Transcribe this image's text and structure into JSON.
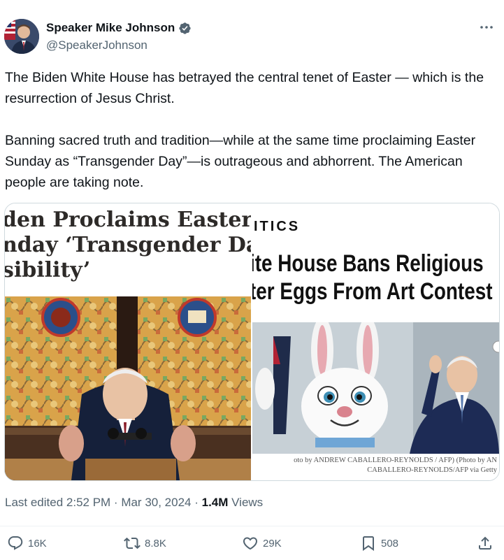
{
  "author": {
    "display_name": "Speaker Mike Johnson",
    "handle": "@SpeakerJohnson",
    "verified": true,
    "verified_color": "#536471"
  },
  "tweet": {
    "paragraphs": [
      "The Biden White House has betrayed the central tenet of Easter — which is the resurrection of Jesus Christ.",
      "Banning sacred truth and tradition—while at the same time proclaiming Easter Sunday as “Transgender Day”—is outrageous and abhorrent. The American people are taking note."
    ]
  },
  "media": {
    "left": {
      "headline_lines": [
        "den Proclaims Easter",
        "nday ‘Transgender Day",
        "sibility’"
      ]
    },
    "right": {
      "section_label": "ITICS",
      "headline_lines": [
        "ite House Bans Religious",
        "ter Eggs From Art Contest"
      ],
      "caption_lines": [
        "oto by ANDREW CABALLERO-REYNOLDS / AFP) (Photo by AN",
        "CABALLERO-REYNOLDS/AFP via Getty"
      ]
    }
  },
  "meta": {
    "edited": "Last edited 2:52 PM · Mar 30, 2024 · ",
    "views_count": "1.4M",
    "views_label": " Views"
  },
  "actions": {
    "replies": "16K",
    "reposts": "8.8K",
    "likes": "29K",
    "bookmarks": "508"
  },
  "icons": [
    "verified-badge-icon",
    "more-icon",
    "reply-icon",
    "repost-icon",
    "like-icon",
    "bookmark-icon",
    "share-icon"
  ]
}
